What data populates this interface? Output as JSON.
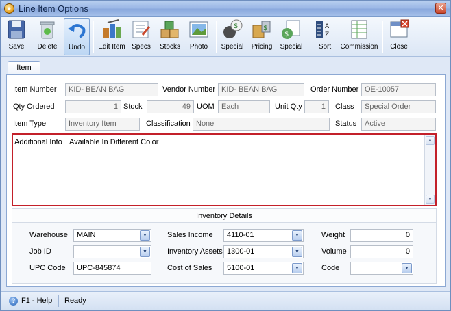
{
  "window": {
    "title": "Line Item Options"
  },
  "toolbar": {
    "save": "Save",
    "delete": "Delete",
    "undo": "Undo",
    "edit_item": "Edit Item",
    "specs": "Specs",
    "stocks": "Stocks",
    "photo": "Photo",
    "special1": "Special",
    "pricing": "Pricing",
    "special2": "Special",
    "sort": "Sort",
    "commission": "Commission",
    "close": "Close"
  },
  "tabs": {
    "item": "Item"
  },
  "form": {
    "item_number_label": "Item Number",
    "item_number": "KID- BEAN BAG",
    "vendor_number_label": "Vendor Number",
    "vendor_number": "KID- BEAN BAG",
    "order_number_label": "Order Number",
    "order_number": "OE-10057",
    "qty_ordered_label": "Qty Ordered",
    "qty_ordered": "1",
    "stock_label": "Stock",
    "stock": "49",
    "uom_label": "UOM",
    "uom": "Each",
    "unit_qty_label": "Unit Qty",
    "unit_qty": "1",
    "class_label": "Class",
    "class": "Special Order",
    "item_type_label": "Item Type",
    "item_type": "Inventory Item",
    "classification_label": "Classification",
    "classification": "None",
    "status_label": "Status",
    "status": "Active",
    "additional_info_label": "Additional Info",
    "additional_info": "Available In Different Color"
  },
  "inventory": {
    "title": "Inventory Details",
    "warehouse_label": "Warehouse",
    "warehouse": "MAIN",
    "job_id_label": "Job ID",
    "job_id": "",
    "upc_code_label": "UPC Code",
    "upc_code": "UPC-845874",
    "sales_income_label": "Sales Income",
    "sales_income": "4110-01",
    "inventory_assets_label": "Inventory Assets",
    "inventory_assets": "1300-01",
    "cost_of_sales_label": "Cost of Sales",
    "cost_of_sales": "5100-01",
    "weight_label": "Weight",
    "weight": "0",
    "volume_label": "Volume",
    "volume": "0",
    "code_label": "Code",
    "code": ""
  },
  "status": {
    "help": "F1 - Help",
    "text": "Ready"
  },
  "colors": {
    "highlight_border": "#c3202a",
    "titlebar": "#9cb8e6"
  }
}
